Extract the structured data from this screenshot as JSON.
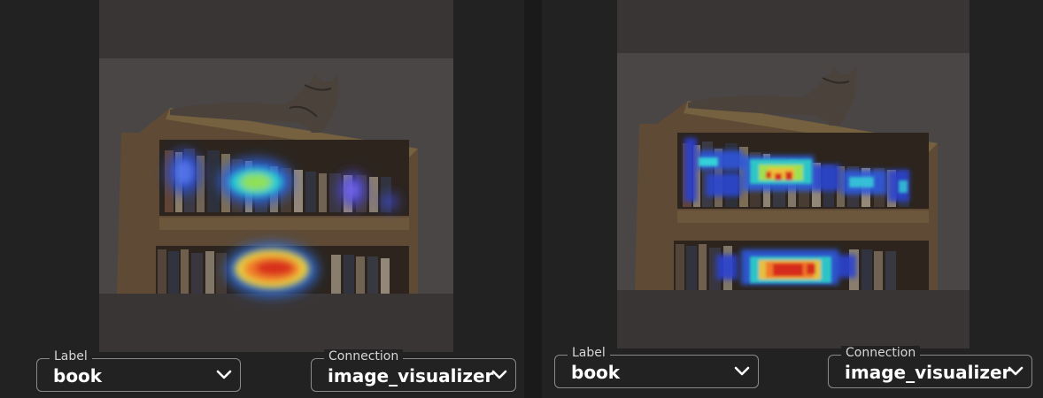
{
  "colors": {
    "page_bg": "#222222",
    "viewer_bg": "#3a3535",
    "field_border": "#8a8a8a",
    "text": "#ffffff"
  },
  "panels": [
    {
      "image": {
        "subject": "cat on bookshelf",
        "heatmap_style": "smooth blobs"
      },
      "label_field": {
        "label": "Label",
        "value": "book",
        "icon": "chevron-down-icon"
      },
      "connection_field": {
        "label": "Connection",
        "value": "image_visualizer",
        "icon": "chevron-down-icon"
      }
    },
    {
      "image": {
        "subject": "cat on bookshelf",
        "heatmap_style": "fine-grained patches"
      },
      "label_field": {
        "label": "Label",
        "value": "book",
        "icon": "chevron-down-icon"
      },
      "connection_field": {
        "label": "Connection",
        "value": "image_visualizer",
        "icon": "chevron-down-icon"
      }
    }
  ]
}
